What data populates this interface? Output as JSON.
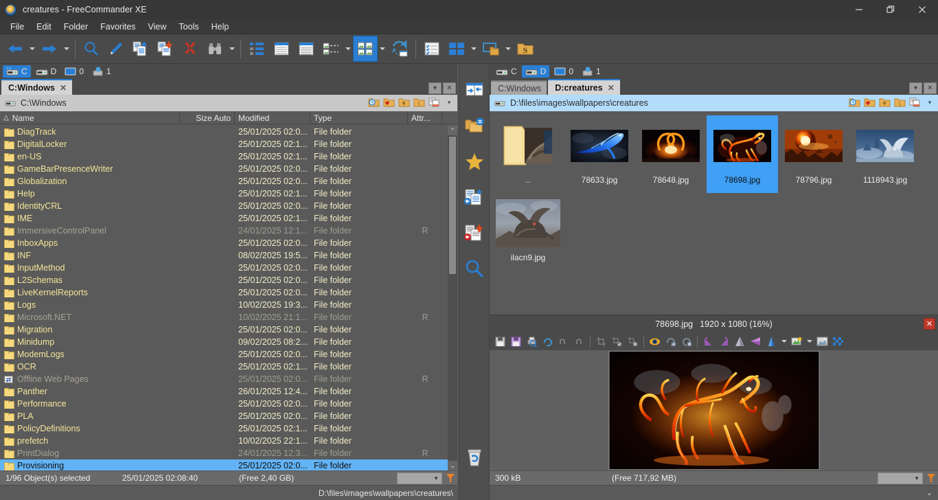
{
  "window": {
    "title": "creatures - FreeCommander XE",
    "app_icon": "freecommander-icon",
    "minimize": "—",
    "maximize": "❐",
    "close": "✕"
  },
  "menu": [
    "File",
    "Edit",
    "Folder",
    "Favorites",
    "View",
    "Tools",
    "Help"
  ],
  "toolbar": [
    {
      "name": "back-button",
      "glyph": "←"
    },
    {
      "name": "back-dropdown",
      "glyph": "▾"
    },
    {
      "name": "forward-button",
      "glyph": "→"
    },
    {
      "name": "forward-dropdown",
      "glyph": "▾"
    },
    {
      "name": "search-button",
      "glyph": "search-icon"
    },
    {
      "name": "edit-button",
      "glyph": "pencil-icon"
    },
    {
      "name": "copy-button",
      "glyph": "copy-icon"
    },
    {
      "name": "move-button",
      "glyph": "move-icon"
    },
    {
      "name": "delete-button",
      "glyph": "delete-icon"
    },
    {
      "name": "compare-button",
      "glyph": "binoculars-icon"
    },
    {
      "name": "tree-view-button",
      "glyph": "tree-icon"
    },
    {
      "name": "details-view-button",
      "glyph": "details-icon"
    },
    {
      "name": "list-view-button",
      "glyph": "list-icon"
    },
    {
      "name": "thumbnail-list-button",
      "glyph": "thumb-list-icon"
    },
    {
      "name": "thumbnail-grid-button",
      "glyph": "thumb-grid-icon"
    },
    {
      "name": "sync-button",
      "glyph": "sync-icon"
    },
    {
      "name": "checklist-button",
      "glyph": "checklist-icon"
    },
    {
      "name": "panels-button",
      "glyph": "panels-icon"
    },
    {
      "name": "desktop-folder-button",
      "glyph": "desktop-folder-icon"
    },
    {
      "name": "settings-folder-button",
      "glyph": "S"
    }
  ],
  "vertical_toolbar": [
    {
      "name": "swap-panels-button",
      "glyph": "swap-icon"
    },
    {
      "name": "folder-equal-button",
      "glyph": "folder-equal-icon"
    },
    {
      "name": "favorites-button",
      "glyph": "star-icon"
    },
    {
      "name": "copy-to-left-button",
      "glyph": "copy-left-icon"
    },
    {
      "name": "move-to-left-button",
      "glyph": "move-left-icon"
    },
    {
      "name": "search-button",
      "glyph": "search-icon"
    },
    {
      "name": "recycle-bin-button",
      "glyph": "trash-icon"
    }
  ],
  "left_pane": {
    "drives": [
      {
        "letter": "C",
        "icon": "hdd-icon",
        "active": true
      },
      {
        "letter": "D",
        "icon": "hdd-icon",
        "active": false
      },
      {
        "letter": "0",
        "icon": "monitor-icon",
        "active": false
      },
      {
        "letter": "1",
        "icon": "network-icon",
        "active": false
      }
    ],
    "tabs": [
      {
        "label": "C:Windows",
        "active": true,
        "close": "✕"
      }
    ],
    "tabbar_buttons": [
      "▾",
      "✕"
    ],
    "address": "C:\\Windows",
    "address_icon": "hdd-icon",
    "address_buttons": [
      "history-folder-icon",
      "favorites-folder-icon",
      "parent-folder-icon",
      "root-folder-icon",
      "copy-path-icon",
      "▾"
    ],
    "columns": [
      {
        "label": "Name",
        "sort": "△"
      },
      {
        "label": "Size Auto"
      },
      {
        "label": "Modified"
      },
      {
        "label": "Type"
      },
      {
        "label": "Attr..."
      }
    ],
    "rows": [
      {
        "icon": "folder-icon",
        "name": "DiagTrack",
        "size": "",
        "modified": "25/01/2025 02:0...",
        "type": "File folder",
        "attr": "",
        "dim": false,
        "selected": false
      },
      {
        "icon": "folder-icon",
        "name": "DigitalLocker",
        "size": "",
        "modified": "25/01/2025 02:1...",
        "type": "File folder",
        "attr": "",
        "dim": false,
        "selected": false
      },
      {
        "icon": "folder-icon",
        "name": "en-US",
        "size": "",
        "modified": "25/01/2025 02:1...",
        "type": "File folder",
        "attr": "",
        "dim": false,
        "selected": false
      },
      {
        "icon": "folder-icon",
        "name": "GameBarPresenceWriter",
        "size": "",
        "modified": "25/01/2025 02:0...",
        "type": "File folder",
        "attr": "",
        "dim": false,
        "selected": false
      },
      {
        "icon": "folder-icon",
        "name": "Globalization",
        "size": "",
        "modified": "25/01/2025 02:0...",
        "type": "File folder",
        "attr": "",
        "dim": false,
        "selected": false
      },
      {
        "icon": "folder-icon",
        "name": "Help",
        "size": "",
        "modified": "25/01/2025 02:1...",
        "type": "File folder",
        "attr": "",
        "dim": false,
        "selected": false
      },
      {
        "icon": "folder-icon",
        "name": "IdentityCRL",
        "size": "",
        "modified": "25/01/2025 02:0...",
        "type": "File folder",
        "attr": "",
        "dim": false,
        "selected": false
      },
      {
        "icon": "folder-icon",
        "name": "IME",
        "size": "",
        "modified": "25/01/2025 02:1...",
        "type": "File folder",
        "attr": "",
        "dim": false,
        "selected": false
      },
      {
        "icon": "folder-icon",
        "name": "ImmersiveControlPanel",
        "size": "",
        "modified": "24/01/2025 12:1...",
        "type": "File folder",
        "attr": "R",
        "dim": true,
        "selected": false
      },
      {
        "icon": "folder-icon",
        "name": "InboxApps",
        "size": "",
        "modified": "25/01/2025 02:0...",
        "type": "File folder",
        "attr": "",
        "dim": false,
        "selected": false
      },
      {
        "icon": "folder-icon",
        "name": "INF",
        "size": "",
        "modified": "08/02/2025 19:5...",
        "type": "File folder",
        "attr": "",
        "dim": false,
        "selected": false
      },
      {
        "icon": "folder-icon",
        "name": "InputMethod",
        "size": "",
        "modified": "25/01/2025 02:0...",
        "type": "File folder",
        "attr": "",
        "dim": false,
        "selected": false
      },
      {
        "icon": "folder-icon",
        "name": "L2Schemas",
        "size": "",
        "modified": "25/01/2025 02:0...",
        "type": "File folder",
        "attr": "",
        "dim": false,
        "selected": false
      },
      {
        "icon": "folder-icon",
        "name": "LiveKernelReports",
        "size": "",
        "modified": "25/01/2025 02:0...",
        "type": "File folder",
        "attr": "",
        "dim": false,
        "selected": false
      },
      {
        "icon": "folder-icon",
        "name": "Logs",
        "size": "",
        "modified": "10/02/2025 19:3...",
        "type": "File folder",
        "attr": "",
        "dim": false,
        "selected": false
      },
      {
        "icon": "folder-icon",
        "name": "Microsoft.NET",
        "size": "",
        "modified": "10/02/2025 21:1...",
        "type": "File folder",
        "attr": "R",
        "dim": true,
        "selected": false
      },
      {
        "icon": "folder-icon",
        "name": "Migration",
        "size": "",
        "modified": "25/01/2025 02:0...",
        "type": "File folder",
        "attr": "",
        "dim": false,
        "selected": false
      },
      {
        "icon": "folder-icon",
        "name": "Minidump",
        "size": "",
        "modified": "09/02/2025 08:2...",
        "type": "File folder",
        "attr": "",
        "dim": false,
        "selected": false
      },
      {
        "icon": "folder-icon",
        "name": "ModemLogs",
        "size": "",
        "modified": "25/01/2025 02:0...",
        "type": "File folder",
        "attr": "",
        "dim": false,
        "selected": false
      },
      {
        "icon": "folder-icon",
        "name": "OCR",
        "size": "",
        "modified": "25/01/2025 02:1...",
        "type": "File folder",
        "attr": "",
        "dim": false,
        "selected": false
      },
      {
        "icon": "web-folder-icon",
        "name": "Offline Web Pages",
        "size": "",
        "modified": "25/01/2025 02:0...",
        "type": "File folder",
        "attr": "R",
        "dim": true,
        "selected": false
      },
      {
        "icon": "folder-icon",
        "name": "Panther",
        "size": "",
        "modified": "26/01/2025 12:4...",
        "type": "File folder",
        "attr": "",
        "dim": false,
        "selected": false
      },
      {
        "icon": "folder-icon",
        "name": "Performance",
        "size": "",
        "modified": "25/01/2025 02:0...",
        "type": "File folder",
        "attr": "",
        "dim": false,
        "selected": false
      },
      {
        "icon": "folder-icon",
        "name": "PLA",
        "size": "",
        "modified": "25/01/2025 02:0...",
        "type": "File folder",
        "attr": "",
        "dim": false,
        "selected": false
      },
      {
        "icon": "folder-icon",
        "name": "PolicyDefinitions",
        "size": "",
        "modified": "25/01/2025 02:1...",
        "type": "File folder",
        "attr": "",
        "dim": false,
        "selected": false
      },
      {
        "icon": "folder-icon",
        "name": "prefetch",
        "size": "",
        "modified": "10/02/2025 22:1...",
        "type": "File folder",
        "attr": "",
        "dim": false,
        "selected": false
      },
      {
        "icon": "folder-icon",
        "name": "PrintDialog",
        "size": "",
        "modified": "24/01/2025 12:3...",
        "type": "File folder",
        "attr": "R",
        "dim": true,
        "selected": false
      },
      {
        "icon": "folder-icon",
        "name": "Provisioning",
        "size": "",
        "modified": "25/01/2025 02:0...",
        "type": "File folder",
        "attr": "",
        "dim": false,
        "selected": true
      }
    ],
    "status": {
      "selection": "1/96 Object(s) selected",
      "timestamp": "25/01/2025 02:08:40",
      "free": "(Free 2,40 GB)",
      "filter_icon": "funnel-icon"
    },
    "bottom_path": "D:\\files\\images\\wallpapers\\creatures\\"
  },
  "right_pane": {
    "drives": [
      {
        "letter": "C",
        "icon": "hdd-icon",
        "active": false
      },
      {
        "letter": "D",
        "icon": "hdd-icon",
        "active": true
      },
      {
        "letter": "0",
        "icon": "monitor-icon",
        "active": false
      },
      {
        "letter": "1",
        "icon": "network-icon",
        "active": false
      }
    ],
    "tabs": [
      {
        "label": "C:Windows",
        "active": false,
        "close": ""
      },
      {
        "label": "D:creatures",
        "active": true,
        "close": "✕"
      }
    ],
    "tabbar_buttons": [
      "▾",
      "✕"
    ],
    "address": "D:\\files\\images\\wallpapers\\creatures",
    "address_icon": "hdd-icon",
    "address_buttons": [
      "history-folder-icon",
      "favorites-folder-icon",
      "parent-folder-icon",
      "root-folder-icon",
      "copy-path-icon",
      "▾"
    ],
    "thumbnails": [
      {
        "name": "..",
        "kind": "parent-folder",
        "selected": false
      },
      {
        "name": "78633.jpg",
        "kind": "blue-phoenix",
        "selected": false
      },
      {
        "name": "78648.jpg",
        "kind": "fire-ring",
        "selected": false
      },
      {
        "name": "78698.jpg",
        "kind": "fire-horse",
        "selected": true
      },
      {
        "name": "78796.jpg",
        "kind": "fire-explosion",
        "selected": false
      },
      {
        "name": "1118943.jpg",
        "kind": "ice-dragon",
        "selected": false
      },
      {
        "name": "ilacn9.jpg",
        "kind": "rock-dragon",
        "selected": false
      }
    ],
    "status": {
      "size": "300 kB",
      "free": "(Free 717,92 MB)",
      "filter_icon": "funnel-icon"
    }
  },
  "viewer": {
    "filename": "78698.jpg",
    "dimensions": "1920 x 1080 (16%)",
    "close": "✕",
    "tools": [
      {
        "name": "save-button",
        "glyph": "save-icon"
      },
      {
        "name": "save-as-button",
        "glyph": "save-as-icon"
      },
      {
        "name": "print-preview-button",
        "glyph": "print-preview-icon"
      },
      {
        "name": "refresh-button",
        "glyph": "refresh-icon"
      },
      {
        "name": "undo-button",
        "glyph": "undo-icon"
      },
      {
        "name": "redo-button",
        "glyph": "redo-icon"
      },
      {
        "name": "crop-button",
        "glyph": "crop-icon"
      },
      {
        "name": "crop-apply-button",
        "glyph": "crop-apply-icon"
      },
      {
        "name": "crop-cancel-button",
        "glyph": "crop-cancel-icon"
      },
      {
        "name": "preview-button",
        "glyph": "eye-icon"
      },
      {
        "name": "rotate-apply-button",
        "glyph": "rotate-apply-icon"
      },
      {
        "name": "rotate-cancel-button",
        "glyph": "rotate-cancel-icon"
      },
      {
        "name": "rotate-left-button",
        "glyph": "rotate-left-icon"
      },
      {
        "name": "rotate-right-button",
        "glyph": "rotate-right-icon"
      },
      {
        "name": "flip-vertical-button",
        "glyph": "flip-v-icon"
      },
      {
        "name": "flip-horizontal-button",
        "glyph": "flip-h-icon"
      },
      {
        "name": "resize-button",
        "glyph": "resize-icon"
      },
      {
        "name": "resize-dropdown",
        "glyph": "▾"
      },
      {
        "name": "effects-button",
        "glyph": "effects-icon"
      },
      {
        "name": "effects-dropdown",
        "glyph": "▾"
      },
      {
        "name": "wallpaper-button",
        "glyph": "wallpaper-icon"
      },
      {
        "name": "transparency-button",
        "glyph": "transparency-icon"
      }
    ]
  }
}
